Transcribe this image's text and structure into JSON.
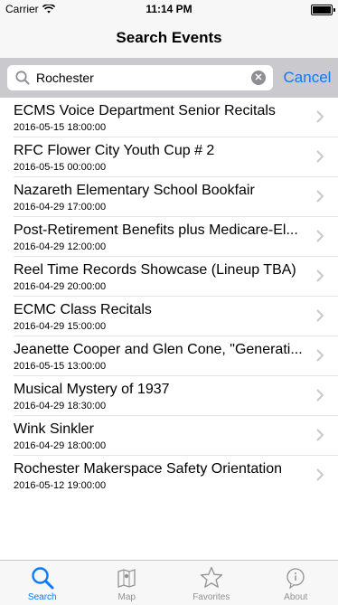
{
  "status": {
    "carrier": "Carrier",
    "time": "11:14 PM"
  },
  "nav": {
    "title": "Search Events"
  },
  "search": {
    "value": "Rochester",
    "cancel_label": "Cancel"
  },
  "results": [
    {
      "title": "ECMS Voice Department Senior Recitals",
      "datetime": "2016-05-15 18:00:00"
    },
    {
      "title": "RFC Flower City Youth Cup # 2",
      "datetime": "2016-05-15 00:00:00"
    },
    {
      "title": "Nazareth Elementary School Bookfair",
      "datetime": "2016-04-29 17:00:00"
    },
    {
      "title": "Post-Retirement Benefits plus Medicare-El...",
      "datetime": "2016-04-29 12:00:00"
    },
    {
      "title": "Reel Time Records Showcase (Lineup TBA)",
      "datetime": "2016-04-29 20:00:00"
    },
    {
      "title": "ECMC Class Recitals",
      "datetime": "2016-04-29 15:00:00"
    },
    {
      "title": "Jeanette Cooper and Glen Cone, \"Generati...",
      "datetime": "2016-05-15 13:00:00"
    },
    {
      "title": "Musical Mystery of 1937",
      "datetime": "2016-04-29 18:30:00"
    },
    {
      "title": "Wink Sinkler",
      "datetime": "2016-04-29 18:00:00"
    },
    {
      "title": "Rochester Makerspace Safety Orientation",
      "datetime": "2016-05-12 19:00:00"
    }
  ],
  "tabs": [
    {
      "label": "Search",
      "icon": "search-icon",
      "active": true
    },
    {
      "label": "Map",
      "icon": "map-icon",
      "active": false
    },
    {
      "label": "Favorites",
      "icon": "star-icon",
      "active": false
    },
    {
      "label": "About",
      "icon": "info-icon",
      "active": false
    }
  ],
  "colors": {
    "accent": "#0a7aff",
    "inactive": "#929292",
    "search_bar_bg": "#c9c9ce"
  }
}
